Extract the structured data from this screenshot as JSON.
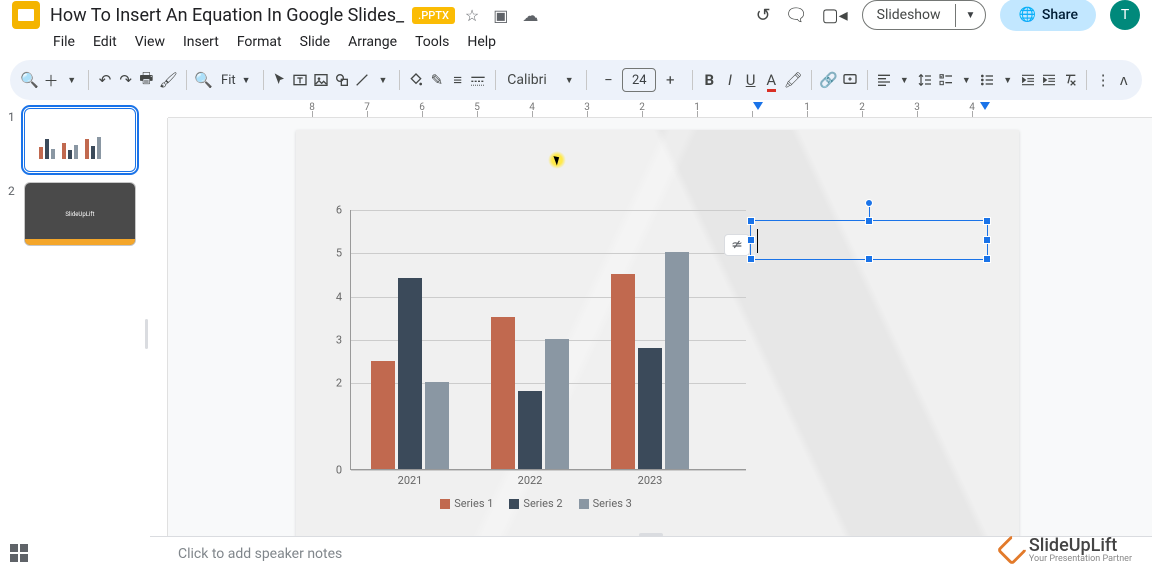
{
  "doc": {
    "title": "How To Insert An Equation In Google Slides_",
    "badge": ".PPTX"
  },
  "menu": [
    "File",
    "Edit",
    "View",
    "Insert",
    "Format",
    "Slide",
    "Arrange",
    "Tools",
    "Help"
  ],
  "header_buttons": {
    "slideshow": "Slideshow",
    "share": "Share",
    "avatar_initial": "T"
  },
  "toolbar": {
    "zoom": "Fit",
    "font": "Calibri",
    "fontsize": "24"
  },
  "thumbnails": [
    {
      "num": "1",
      "selected": true
    },
    {
      "num": "2",
      "selected": false,
      "label": "SlideUpLift"
    }
  ],
  "ruler_h_labels": [
    "8",
    "7",
    "6",
    "5",
    "4",
    "3",
    "2",
    "1",
    "",
    "1",
    "2",
    "3",
    "4"
  ],
  "chart_data": {
    "type": "bar",
    "categories": [
      "2021",
      "2022",
      "2023"
    ],
    "series": [
      {
        "name": "Series 1",
        "color": "#c1694f",
        "values": [
          2.5,
          3.5,
          4.5
        ]
      },
      {
        "name": "Series 2",
        "color": "#3b4a5a",
        "values": [
          4.4,
          1.8,
          2.8
        ]
      },
      {
        "name": "Series 3",
        "color": "#8a97a3",
        "values": [
          2.0,
          3.0,
          5.0
        ]
      }
    ],
    "y_ticks": [
      0,
      2,
      3,
      4,
      5,
      6
    ],
    "ylim": [
      0,
      6
    ]
  },
  "speaker_notes_placeholder": "Click to add speaker notes",
  "watermark": {
    "main": "SlideUpLift",
    "sub": "Your Presentation Partner"
  }
}
